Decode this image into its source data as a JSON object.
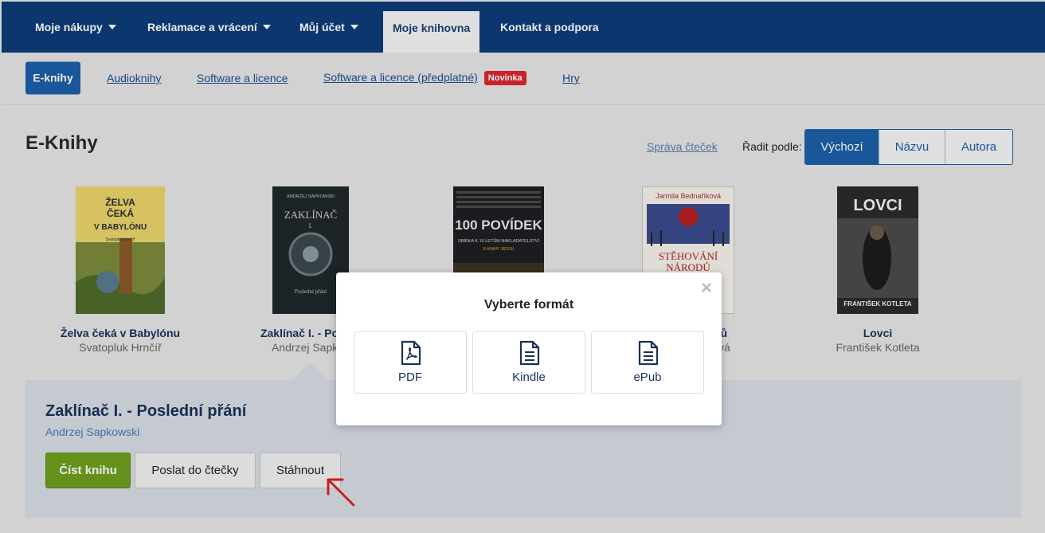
{
  "topnav": {
    "items": [
      {
        "label": "Moje nákupy",
        "caret": true
      },
      {
        "label": "Reklamace a vrácení",
        "caret": true
      },
      {
        "label": "Můj účet",
        "caret": true
      },
      {
        "label": "Moje knihovna",
        "caret": false,
        "active": true
      },
      {
        "label": "Kontakt a podpora",
        "caret": false
      }
    ]
  },
  "subnav": {
    "tabs": [
      {
        "label": "E-knihy",
        "active": true
      },
      {
        "label": "Audioknihy"
      },
      {
        "label": "Software a licence"
      },
      {
        "label": "Software a licence (předplatné)",
        "badge": "Novinka"
      },
      {
        "label": "Hry"
      }
    ]
  },
  "header": {
    "title": "E-Knihy",
    "manage_link": "Správa čteček",
    "sort_label": "Řadit podle:",
    "sort_options": [
      "Výchozí",
      "Názvu",
      "Autora"
    ],
    "sort_active": "Výchozí"
  },
  "books": [
    {
      "title": "Želva čeká v Babylónu",
      "author": "Svatopluk Hrnčíř",
      "cover_text": [
        "ŽELVA",
        "ČEKÁ",
        "V BABYLÓNU",
        "Svatopluk Hrnčíř"
      ]
    },
    {
      "title": "Zaklínač I. - Posled",
      "author": "Andrzej Sapkov",
      "cover_text": [
        "ANDRZEJ SAPKOWSKI",
        "ZAKLÍNAČ",
        "I.",
        "Poslední přání"
      ]
    },
    {
      "title": "",
      "author": "",
      "cover_text": [
        "100 POVÍDEK",
        "SBÍRKA K 10 LETŮM NAKLADATELSTVÍ",
        "E-KNIHY JEDOU"
      ]
    },
    {
      "title": "dů",
      "author": "vá",
      "cover_text": [
        "Jarmila Bednaříková",
        "STĚHOVÁNÍ",
        "NÁRODŮ"
      ]
    },
    {
      "title": "Lovci",
      "author": "František Kotleta",
      "cover_text": [
        "LOVCI",
        "FRANTIŠEK KOTLETA"
      ]
    }
  ],
  "detail": {
    "title": "Zaklínač I. - Poslední přání",
    "author": "Andrzej Sapkowski",
    "buttons": {
      "read": "Číst knihu",
      "send": "Poslat do čtečky",
      "download": "Stáhnout"
    }
  },
  "modal": {
    "title": "Vyberte formát",
    "close": "×",
    "formats": [
      {
        "label": "PDF",
        "icon": "pdf-file-icon"
      },
      {
        "label": "Kindle",
        "icon": "document-file-icon"
      },
      {
        "label": "ePub",
        "icon": "document-file-icon"
      }
    ]
  },
  "colors": {
    "nav_bg": "#0d3b78",
    "accent": "#1b5fa7",
    "read_button": "#6e9d1e",
    "badge": "#d9262e",
    "annotation_arrow": "#e02020"
  }
}
